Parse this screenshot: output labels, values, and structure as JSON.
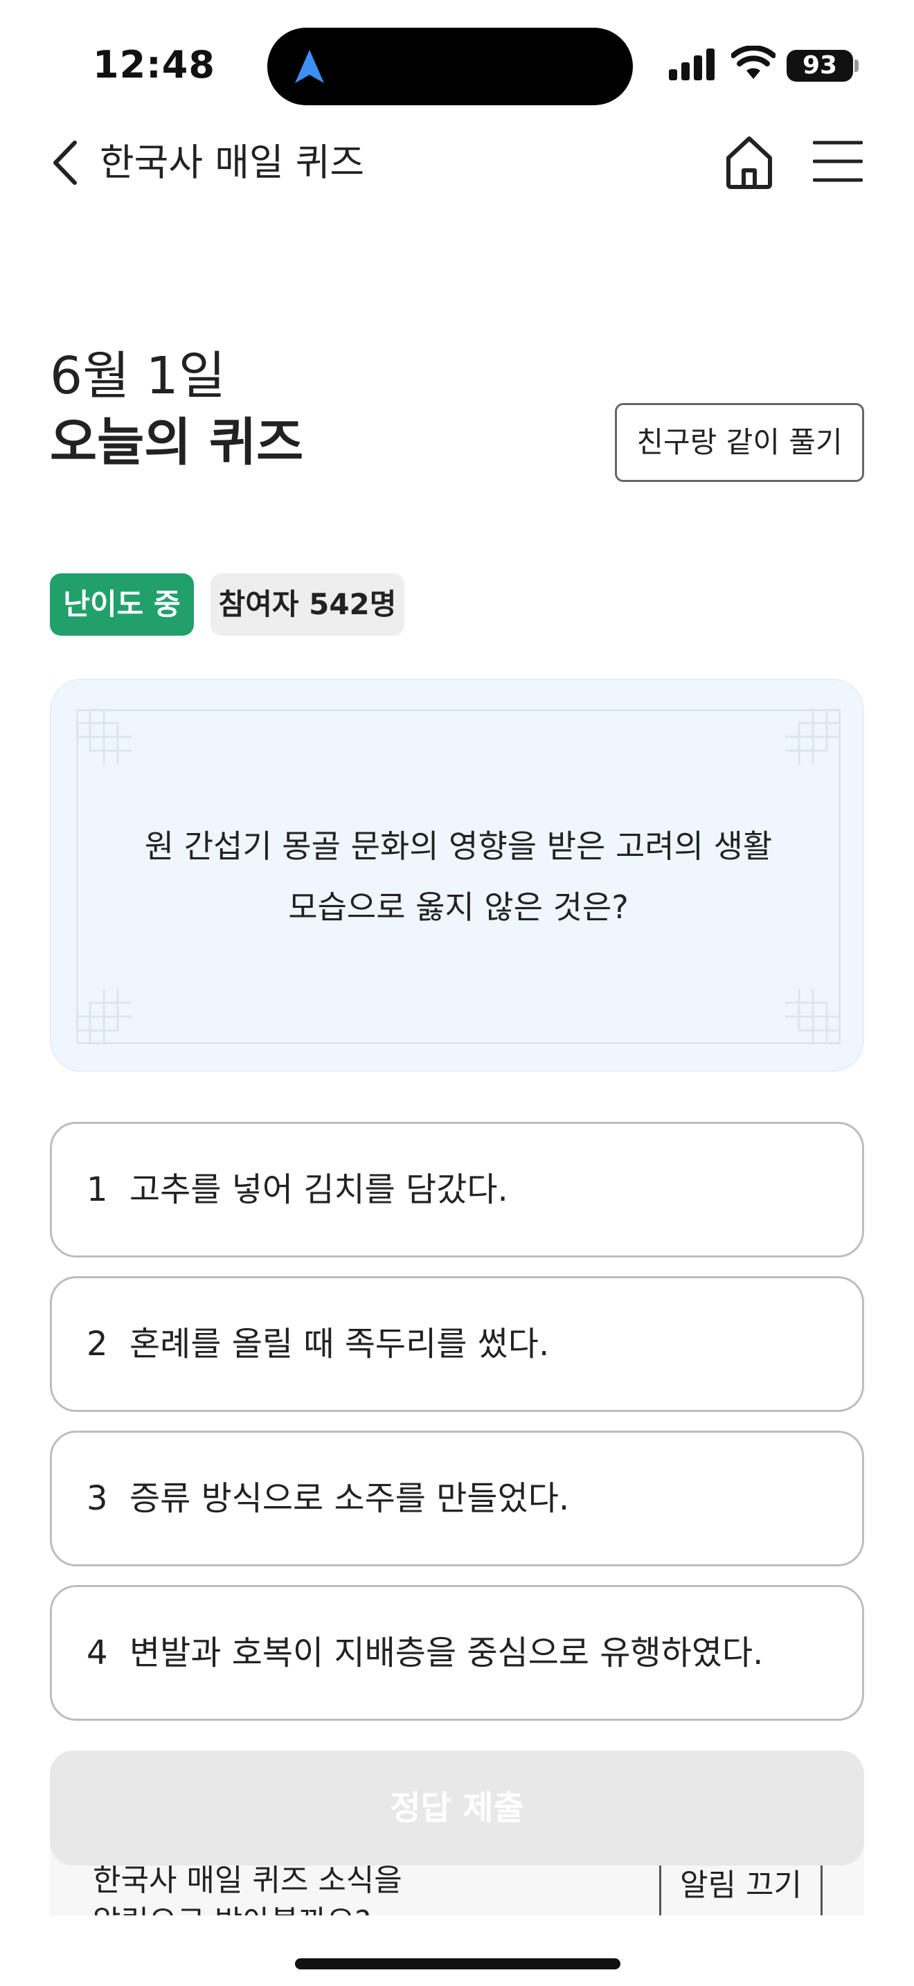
{
  "status_bar": {
    "time": "12:48",
    "battery": "93",
    "icons": [
      "location-arrow-icon",
      "signal-icon",
      "wifi-icon",
      "battery-icon"
    ]
  },
  "header": {
    "title": "한국사 매일 퀴즈",
    "icons": [
      "back-chevron-icon",
      "home-icon",
      "hamburger-menu-icon"
    ]
  },
  "quiz": {
    "date": "6월 1일",
    "heading": "오늘의 퀴즈",
    "together_button": "친구랑 같이 풀기",
    "difficulty": "난이도 중",
    "participants": "참여자 542명",
    "question_line1": "원 간섭기 몽골 문화의 영향을 받은 고려의 생활",
    "question_line2": "모습으로 옳지 않은 것은?",
    "options": [
      {
        "num": "1",
        "text": "고추를 넣어 김치를 담갔다."
      },
      {
        "num": "2",
        "text": "혼례를 올릴 때 족두리를 썼다."
      },
      {
        "num": "3",
        "text": "증류 방식으로 소주를 만들었다."
      },
      {
        "num": "4",
        "text": "변발과 호복이 지배층을 중심으로 유행하였다."
      }
    ],
    "submit_label": "정답 제출"
  },
  "notification": {
    "text_line1": "한국사 매일 퀴즈 소식을",
    "text_line2": "알림으로 받아볼까요?",
    "off_label": "알림 끄기"
  },
  "colors": {
    "accent_green": "#21a06c",
    "card_bg": "#f0f6fd",
    "submit_disabled": "#e8e8e8"
  }
}
